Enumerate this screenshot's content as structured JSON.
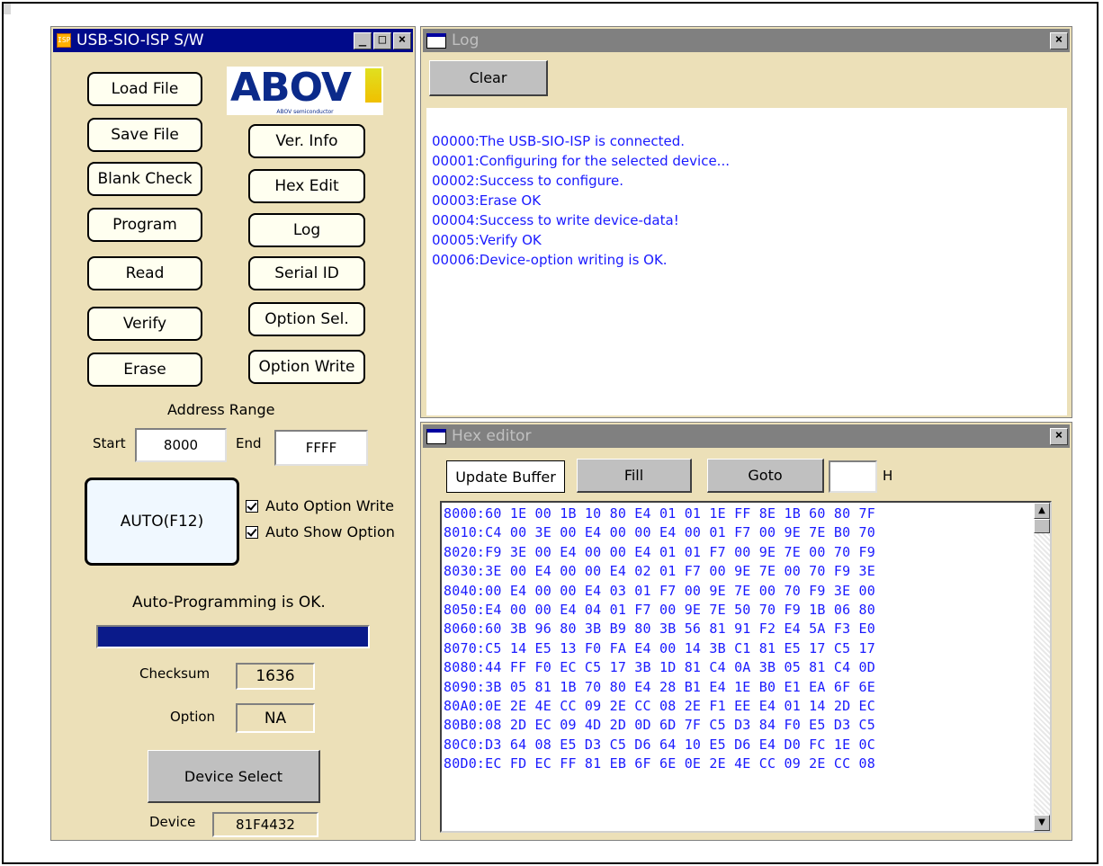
{
  "main_window": {
    "title": "USB-SIO-ISP S/W",
    "icon_text": "ISP",
    "logo_text": "ABOV",
    "logo_subtext": "ABOV semiconductor",
    "buttons": {
      "load_file": "Load File",
      "save_file": "Save File",
      "blank_check": "Blank Check",
      "program": "Program",
      "read": "Read",
      "verify": "Verify",
      "erase": "Erase",
      "ver_info": "Ver. Info",
      "hex_edit": "Hex Edit",
      "log": "Log",
      "serial_id": "Serial ID",
      "option_sel": "Option Sel.",
      "option_write": "Option Write",
      "auto": "AUTO(F12)",
      "device_select": "Device Select"
    },
    "address_range": {
      "label": "Address Range",
      "start_label": "Start",
      "start_value": "8000",
      "end_label": "End",
      "end_value": "FFFF"
    },
    "checkboxes": {
      "auto_option_write": "Auto Option Write",
      "auto_show_option": "Auto Show Option"
    },
    "status_text": "Auto-Programming is OK.",
    "progress": 1.0,
    "checksum_label": "Checksum",
    "checksum_value": "1636",
    "option_label": "Option",
    "option_value": "NA",
    "device_label": "Device",
    "device_value": "81F4432"
  },
  "log_window": {
    "title": "Log",
    "clear_label": "Clear",
    "lines": [
      "00000:The USB-SIO-ISP is connected.",
      "00001:Configuring for the selected device...",
      "00002:Success to configure.",
      "00003:Erase OK",
      "00004:Success to write device-data!",
      "00005:Verify OK",
      "00006:Device-option writing is OK."
    ]
  },
  "hex_window": {
    "title": "Hex editor",
    "update_buffer_label": "Update Buffer",
    "fill_label": "Fill",
    "goto_label": "Goto",
    "goto_value": "",
    "goto_suffix": "H",
    "rows": [
      "8000:60 1E 00 1B 10 80 E4 01 01 1E FF 8E 1B 60 80 7F",
      "8010:C4 00 3E 00 E4 00 00 E4 00 01 F7 00 9E 7E B0 70",
      "8020:F9 3E 00 E4 00 00 E4 01 01 F7 00 9E 7E 00 70 F9",
      "8030:3E 00 E4 00 00 E4 02 01 F7 00 9E 7E 00 70 F9 3E",
      "8040:00 E4 00 00 E4 03 01 F7 00 9E 7E 00 70 F9 3E 00",
      "8050:E4 00 00 E4 04 01 F7 00 9E 7E 50 70 F9 1B 06 80",
      "8060:60 3B 96 80 3B B9 80 3B 56 81 91 F2 E4 5A F3 E0",
      "8070:C5 14 E5 13 F0 FA E4 00 14 3B C1 81 E5 17 C5 17",
      "8080:44 FF F0 EC C5 17 3B 1D 81 C4 0A 3B 05 81 C4 0D",
      "8090:3B 05 81 1B 70 80 E4 28 B1 E4 1E B0 E1 EA 6F 6E",
      "80A0:0E 2E 4E CC 09 2E CC 08 2E F1 EE E4 01 14 2D EC",
      "80B0:08 2D EC 09 4D 2D 0D 6D 7F C5 D3 84 F0 E5 D3 C5",
      "80C0:D3 64 08 E5 D3 C5 D6 64 10 E5 D6 E4 D0 FC 1E 0C",
      "80D0:EC FD EC FF 81 EB 6F 6E 0E 2E 4E CC 09 2E CC 08"
    ]
  }
}
